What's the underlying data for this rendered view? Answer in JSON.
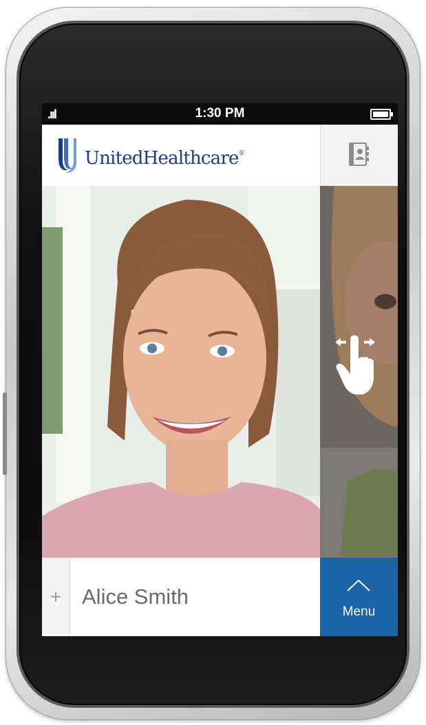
{
  "status_bar": {
    "signal": ".ııl",
    "time": "1:30 PM",
    "battery_icon": "battery-full-icon"
  },
  "header": {
    "brand_name": "UnitedHealthcare",
    "brand_registered": "®",
    "brand_color": "#1e3c85",
    "contact_icon": "contact-card-icon"
  },
  "carousel": {
    "slide_count": 3,
    "active_index": 0,
    "active_dot_color": "#1a63a6",
    "inactive_dot_color": "#ffffff",
    "hint_icon": "swipe-gesture-icon"
  },
  "footer": {
    "add_symbol": "+",
    "member_name": "Alice Smith",
    "menu_label": "Menu",
    "menu_color": "#1a63a6"
  }
}
